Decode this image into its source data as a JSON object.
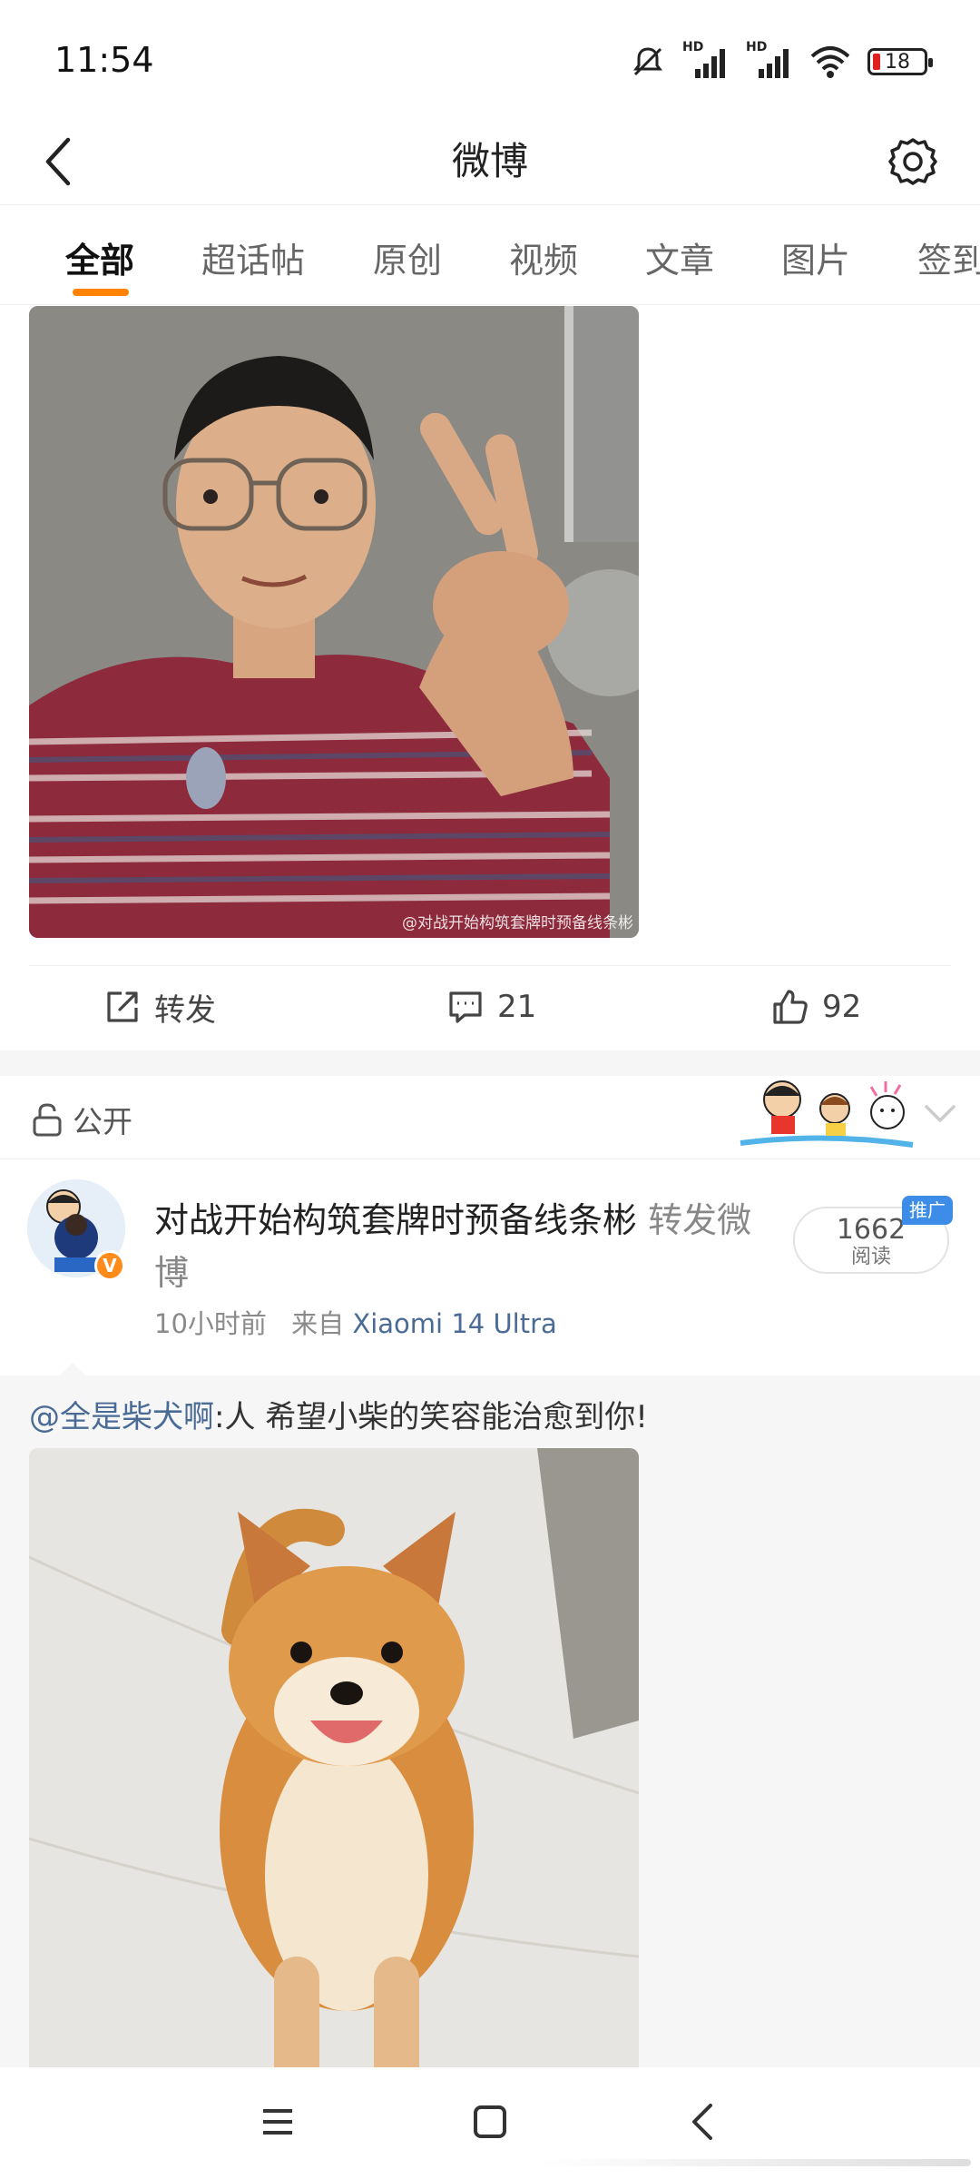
{
  "status_bar": {
    "time": "11:54",
    "battery_level": "18",
    "signal_labels": [
      "HD",
      "HD"
    ],
    "icons": [
      "mute-icon",
      "signal-icon",
      "signal-icon",
      "wifi-icon",
      "battery-icon"
    ]
  },
  "header": {
    "title": "微博",
    "back_icon": "chevron-left-icon",
    "settings_icon": "gear-icon"
  },
  "tabs": [
    {
      "label": "全部",
      "active": true
    },
    {
      "label": "超话帖",
      "active": false
    },
    {
      "label": "原创",
      "active": false
    },
    {
      "label": "视频",
      "active": false
    },
    {
      "label": "文章",
      "active": false
    },
    {
      "label": "图片",
      "active": false
    },
    {
      "label": "签到",
      "active": false
    }
  ],
  "post1": {
    "image_watermark": "@对战开始构筑套牌时预备线条彬",
    "repost_label": "转发",
    "comment_count": "21",
    "like_count": "92"
  },
  "post2": {
    "visibility": "公开",
    "author": "对战开始构筑套牌时预备线条彬",
    "action_word": "转发微博",
    "time": "10小时前",
    "source_prefix": "来自",
    "device": "Xiaomi 14 Ultra",
    "read_count": "1662",
    "read_label": "阅读",
    "promo_label": "推广",
    "mention": "@全是柴犬啊",
    "repost_text": ":人 希望小柴的笑容能治愈到你!"
  },
  "colors": {
    "accent": "#ff8200",
    "link": "#4a6b95",
    "promo": "#3d8de8",
    "feed_bg": "#f6f6f6"
  }
}
